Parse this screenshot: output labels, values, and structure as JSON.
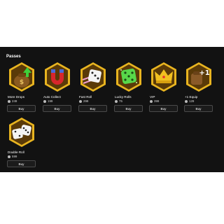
{
  "section": {
    "title": "Passes"
  },
  "passes": [
    {
      "name": "More Drops",
      "price": "249",
      "buy": "Buy",
      "icon": "money-bag-arrow-icon"
    },
    {
      "name": "Auto Collect",
      "price": "199",
      "buy": "Buy",
      "icon": "magnet-icon"
    },
    {
      "name": "Fast Roll",
      "price": "299",
      "buy": "Buy",
      "icon": "speed-dice-icon"
    },
    {
      "name": "Lucky Rolls",
      "price": "75",
      "buy": "Buy",
      "icon": "green-dice-icon"
    },
    {
      "name": "VIP",
      "price": "399",
      "buy": "Buy",
      "icon": "crown-icon"
    },
    {
      "name": "+1 Equip",
      "price": "129",
      "buy": "Buy",
      "icon": "plus-one-bag-icon"
    },
    {
      "name": "Double Roll",
      "price": "599",
      "buy": "Buy",
      "icon": "double-dice-icon"
    }
  ],
  "colors": {
    "badge_border": "#e8b420",
    "badge_inner": "#6e4a0a",
    "background": "#121212"
  }
}
